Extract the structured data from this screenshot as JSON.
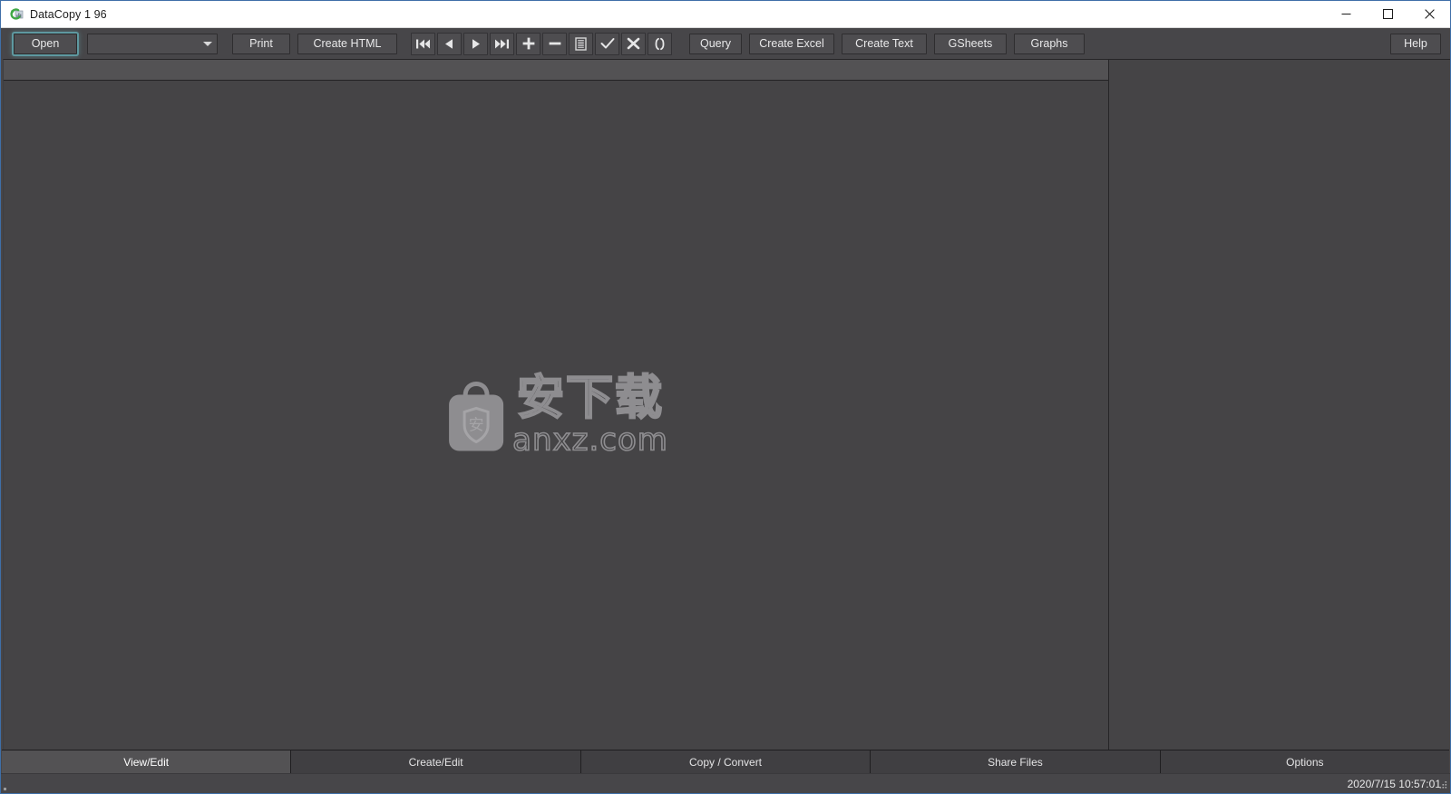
{
  "window": {
    "title": "DataCopy 1 96",
    "app_icon": "refresh-data-icon",
    "minimize_label": "Minimize",
    "maximize_label": "Maximize",
    "close_label": "Close"
  },
  "toolbar": {
    "open_label": "Open",
    "file_select_value": "",
    "file_select_placeholder": "",
    "print_label": "Print",
    "create_html_label": "Create HTML",
    "query_label": "Query",
    "create_excel_label": "Create Excel",
    "create_text_label": "Create Text",
    "gsheets_label": "GSheets",
    "graphs_label": "Graphs",
    "help_label": "Help",
    "nav_icons": [
      {
        "name": "first-record-icon",
        "glyph": "first"
      },
      {
        "name": "previous-record-icon",
        "glyph": "prev"
      },
      {
        "name": "next-record-icon",
        "glyph": "next"
      },
      {
        "name": "last-record-icon",
        "glyph": "last"
      },
      {
        "name": "add-record-icon",
        "glyph": "plus"
      },
      {
        "name": "delete-record-icon",
        "glyph": "minus"
      },
      {
        "name": "edit-record-icon",
        "glyph": "list"
      },
      {
        "name": "confirm-edit-icon",
        "glyph": "check"
      },
      {
        "name": "cancel-edit-icon",
        "glyph": "cross"
      },
      {
        "name": "refresh-icon",
        "glyph": "parens"
      }
    ]
  },
  "content": {
    "watermark": {
      "brand_cn": "安下载",
      "brand_domain": "anxz.com",
      "shield_char": "安"
    }
  },
  "tabs": [
    {
      "label": "View/Edit",
      "name": "tab-view-edit",
      "active": true
    },
    {
      "label": "Create/Edit",
      "name": "tab-create-edit",
      "active": false
    },
    {
      "label": "Copy / Convert",
      "name": "tab-copy-convert",
      "active": false
    },
    {
      "label": "Share Files",
      "name": "tab-share-files",
      "active": false
    },
    {
      "label": "Options",
      "name": "tab-options",
      "active": false
    }
  ],
  "statusbar": {
    "timestamp": "2020/7/15 10:57:01"
  },
  "colors": {
    "window_border": "#3f6fa8",
    "toolbar_bg": "#474649",
    "panel_bg": "#454446",
    "header_bg": "#535254",
    "text": "#e9e9ea",
    "focus_glow": "#6ec8d2",
    "accent_icon_green": "#4caf50"
  }
}
